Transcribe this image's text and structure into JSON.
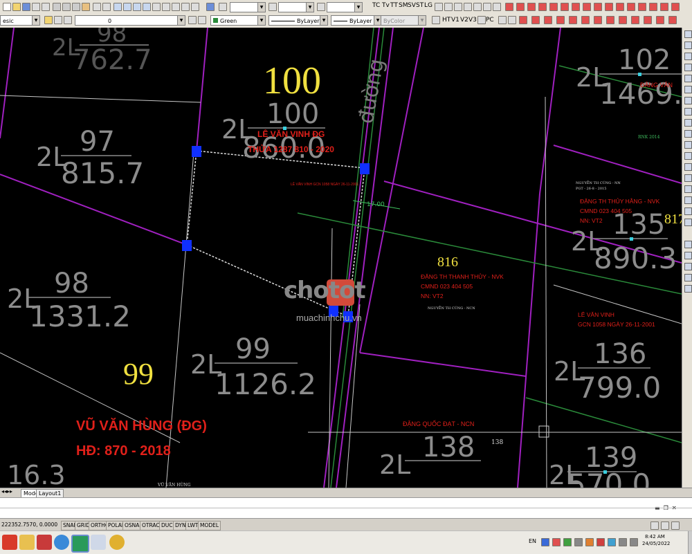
{
  "toolbar": {
    "text_buttons": [
      "TC",
      "Tv",
      "TT",
      "SM",
      "SV",
      "ST",
      "LG"
    ],
    "hv_buttons": [
      "HT",
      "V1",
      "V2",
      "V3"
    ],
    "pc_label": "PC",
    "style_combo": "esic",
    "layer_combo": "0",
    "color_combo": "Green",
    "linetype_combo": "ByLayer",
    "lineweight_combo": "ByLayer",
    "plotstyle_combo": "ByColor"
  },
  "drawing": {
    "parcels": [
      {
        "sheet": "2L",
        "number": "98",
        "area": "762.7"
      },
      {
        "sheet": "2L",
        "number": "100",
        "area": "860.0"
      },
      {
        "sheet": "2L",
        "number": "97",
        "area": "815.7"
      },
      {
        "sheet": "2L",
        "number": "98",
        "area": "1331.2"
      },
      {
        "sheet": "2L",
        "number": "99",
        "area": "1126.2"
      },
      {
        "sheet": "2L",
        "number": "102",
        "area": "1469.5"
      },
      {
        "sheet": "2L",
        "number": "135",
        "area": "890.3"
      },
      {
        "sheet": "2L",
        "number": "136",
        "area": "799.0"
      },
      {
        "sheet": "2L",
        "number": "138",
        "area": ""
      },
      {
        "sheet": "2L",
        "number": "139",
        "area": "570.0"
      },
      {
        "sheet": "",
        "number": "16.3",
        "area": ""
      }
    ],
    "big_label_100": "100",
    "big_label_99": "99",
    "label_816": "816",
    "label_817": "817",
    "label_138": "138",
    "road_label": "đường",
    "dim_road": "17.00",
    "owners": {
      "p100_line1": "LÊ VĂN VINH ĐG",
      "p100_line2": "THỬA 1287  810 - 2020",
      "p100_small": "LÊ VĂN VINH\nGCN 1058 NGÀY 26-11-2001",
      "p99_line1": "VŨ VĂN HÙNG (ĐG)",
      "p99_line2": "HĐ: 870 - 2018",
      "p99_small": "VŨ VĂN HÙNG",
      "p816_line1": "ĐẶNG TH THANH THỦY - NVK",
      "p816_line2": "CMND 023 404 505",
      "p816_line3": "NN: VT2",
      "p816_small": "NGUYỄN TH CÚNG - NCN",
      "p135_small1": "NGUYỄN TH CÚNG - NN",
      "p135_small2": "PGT - 26-8 - 2015",
      "p135_line1": "ĐẶNG TH THỦY HẰNG - NVK",
      "p135_line2": "CMND 023 404 505",
      "p135_line3": "NN: VT2",
      "p136_line1": "LÊ VĂN VINH",
      "p136_line2": "GCN 1058 NGÀY 26-11-2001",
      "p138_owner": "ĐẶNG QUỐC ĐẠT - NCN",
      "p102_owner": "ĐẶNG VĂN",
      "rnk_label": "RNK 2014"
    }
  },
  "watermark": {
    "brand": "chotot",
    "site": "muachinhchu.vn"
  },
  "tabs": {
    "model": "Model",
    "layout1": "Layout1"
  },
  "status": {
    "coords": "222352.7570, 0.0000",
    "buttons": [
      "SNAP",
      "GRID",
      "ORTHO",
      "POLAR",
      "OSNAP",
      "OTRACK",
      "DUCS",
      "DYN",
      "LWT",
      "MODEL"
    ]
  },
  "taskbar": {
    "lang": "EN",
    "time": "8:42 AM",
    "date": "24/05/2022"
  },
  "colors": {
    "cad_bg": "#000000",
    "boundary_magenta": "#a020c0",
    "boundary_green": "#2a8a3a",
    "text_white": "#e0e0e0",
    "text_yellow": "#f0e040",
    "text_red": "#e0201a",
    "grip_blue": "#1030ff"
  }
}
